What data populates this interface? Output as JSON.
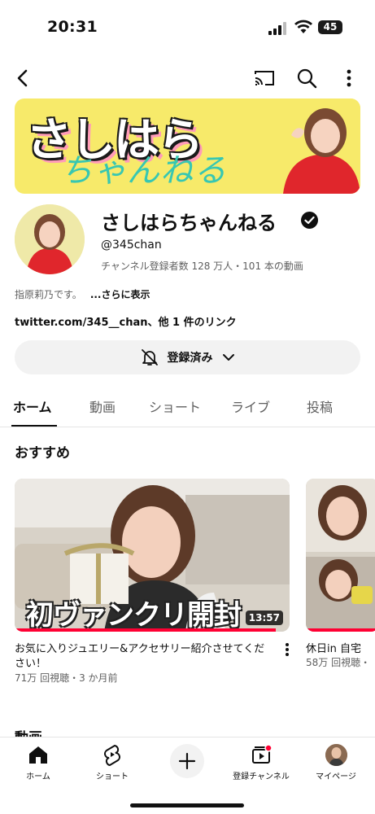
{
  "status_bar": {
    "time": "20:31",
    "battery": "45"
  },
  "banner": {
    "title": "さしはら",
    "subtitle": "ちゃんねる"
  },
  "channel": {
    "name": "さしはらちゃんねる",
    "handle": "@345chan",
    "stats": "チャンネル登録者数 128 万人・101 本の動画",
    "description": "指原莉乃です。",
    "more_label": "...さらに表示",
    "links": "twitter.com/345__chan、他 1 件のリンク",
    "subscribe_label": "登録済み"
  },
  "tabs": [
    {
      "label": "ホーム"
    },
    {
      "label": "動画"
    },
    {
      "label": "ショート"
    },
    {
      "label": "ライブ"
    },
    {
      "label": "投稿"
    }
  ],
  "sections": {
    "recommended_title": "おすすめ",
    "next_title": "動画"
  },
  "videos": [
    {
      "thumbnail_caption": "初ヴァンクリ開封",
      "duration": "13:57",
      "title": "お気に入りジュエリー&アクセサリー紹介させてください！",
      "meta": "71万 回視聴・3 か月前",
      "watched_fraction": 0.95
    },
    {
      "title": "休日in 自宅",
      "meta": "58万 回視聴・"
    }
  ],
  "bottom_nav": [
    {
      "label": "ホーム",
      "icon": "home-icon"
    },
    {
      "label": "ショート",
      "icon": "shorts-icon"
    },
    {
      "label": "",
      "icon": "create-icon"
    },
    {
      "label": "登録チャンネル",
      "icon": "subscriptions-icon"
    },
    {
      "label": "マイページ",
      "icon": "profile-avatar"
    }
  ],
  "colors": {
    "accent": "#ff0033",
    "banner_bg": "#f7ea6a",
    "chip_bg": "#f2f2f2"
  }
}
